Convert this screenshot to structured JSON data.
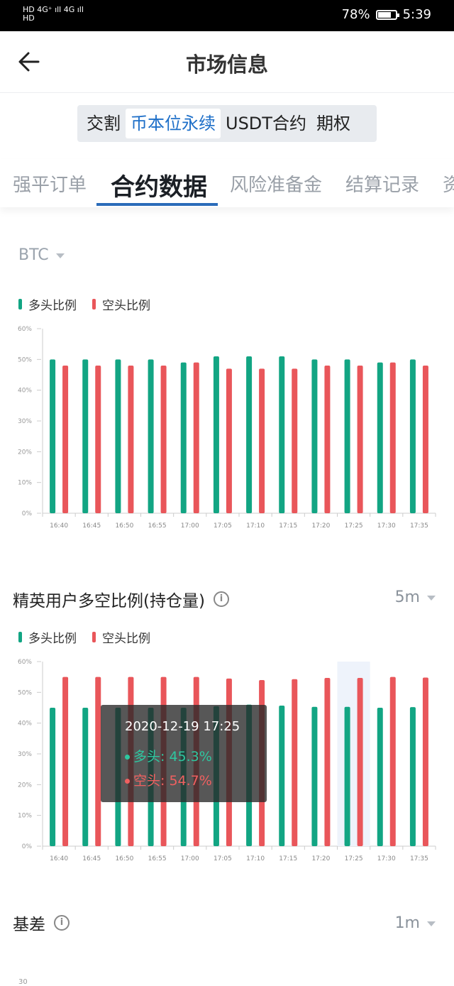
{
  "status_bar": {
    "network_line1": "HD 4G⁺ ıll 4G ıll",
    "network_line2": "HD",
    "battery": "78%",
    "time": "5:39",
    "battery_level": 0.78
  },
  "header": {
    "title": "市场信息",
    "back_icon": "arrow-left-icon"
  },
  "segments": [
    {
      "label": "交割",
      "active": false
    },
    {
      "label": "币本位永续",
      "active": true
    },
    {
      "label": "USDT合约",
      "active": false
    },
    {
      "label": "期权",
      "active": false
    }
  ],
  "tabs": [
    {
      "label": "强平订单",
      "active": false
    },
    {
      "label": "合约数据",
      "active": true
    },
    {
      "label": "风险准备金",
      "active": false
    },
    {
      "label": "结算记录",
      "active": false
    },
    {
      "label": "资",
      "active": false
    }
  ],
  "coin_select": "BTC",
  "legend": {
    "long": "多头比例",
    "short": "空头比例",
    "long_color": "#12a583",
    "short_color": "#e9565a"
  },
  "section2": {
    "title": "精英用户多空比例(持仓量)",
    "interval": "5m"
  },
  "section3": {
    "title": "基差",
    "interval": "1m",
    "first_tick": "30"
  },
  "tooltip": {
    "time": "2020-12-19 17:25",
    "long": "多头: 45.3%",
    "short": "空头: 54.7%"
  },
  "chart_data": [
    {
      "type": "bar",
      "categories": [
        "16:40",
        "16:45",
        "16:50",
        "16:55",
        "17:00",
        "17:05",
        "17:10",
        "17:15",
        "17:20",
        "17:25",
        "17:30",
        "17:35"
      ],
      "yticks": [
        "0%",
        "10%",
        "20%",
        "30%",
        "40%",
        "50%",
        "60%"
      ],
      "ylim": [
        0,
        60
      ],
      "series": [
        {
          "name": "多头比例",
          "values": [
            50,
            50,
            50,
            50,
            49,
            51,
            51,
            51,
            50,
            50,
            49,
            50
          ]
        },
        {
          "name": "空头比例",
          "values": [
            48,
            48,
            48,
            48,
            49,
            47,
            47,
            47,
            48,
            48,
            49,
            48
          ]
        }
      ]
    },
    {
      "type": "bar",
      "title": "精英用户多空比例(持仓量)",
      "categories": [
        "16:40",
        "16:45",
        "16:50",
        "16:55",
        "17:00",
        "17:05",
        "17:10",
        "17:15",
        "17:20",
        "17:25",
        "17:30",
        "17:35"
      ],
      "yticks": [
        "0%",
        "10%",
        "20%",
        "30%",
        "40%",
        "50%",
        "60%"
      ],
      "ylim": [
        0,
        60
      ],
      "highlight_category": "17:25",
      "series": [
        {
          "name": "多头比例",
          "values": [
            45,
            45,
            45,
            45,
            45,
            45.5,
            46,
            45.7,
            45.3,
            45.3,
            45,
            45.2
          ]
        },
        {
          "name": "空头比例",
          "values": [
            55,
            55,
            55,
            55,
            55,
            54.5,
            54,
            54.3,
            54.7,
            54.7,
            55,
            54.8
          ]
        }
      ]
    }
  ]
}
